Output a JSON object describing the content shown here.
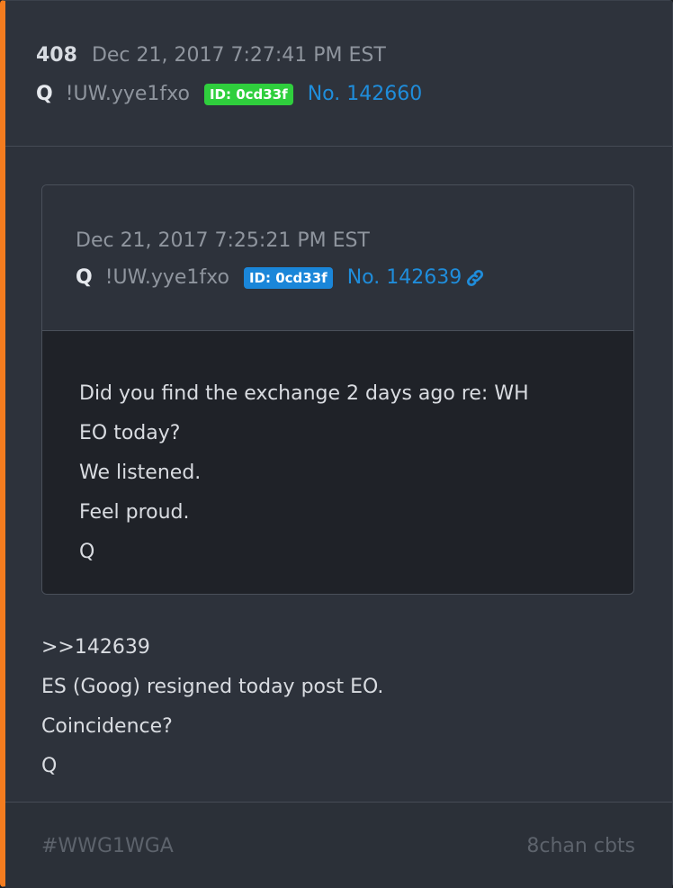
{
  "post": {
    "number": "408",
    "date": "Dec 21, 2017 7:27:41 PM EST",
    "author": "Q",
    "tripcode": "!UW.yye1fxo",
    "id_badge": "ID: 0cd33f",
    "post_no": "No. 142660"
  },
  "quote": {
    "date": "Dec 21, 2017 7:25:21 PM EST",
    "author": "Q",
    "tripcode": "!UW.yye1fxo",
    "id_badge": "ID: 0cd33f",
    "post_no": "No. 142639",
    "lines": [
      "Did you find the exchange 2 days ago re: WH",
      "EO today?",
      "We listened.",
      "Feel proud.",
      "Q"
    ]
  },
  "body": {
    "lines": [
      ">>142639",
      "ES (Goog) resigned today post EO.",
      "Coincidence?",
      "Q"
    ]
  },
  "footer": {
    "hashtag": "#WWG1WGA",
    "source": "8chan cbts"
  },
  "colors": {
    "accent_left": "#f47c1f",
    "id_badge_main": "#2fcf3d",
    "id_badge_quote": "#1a86d9",
    "link": "#1f8ddb"
  }
}
